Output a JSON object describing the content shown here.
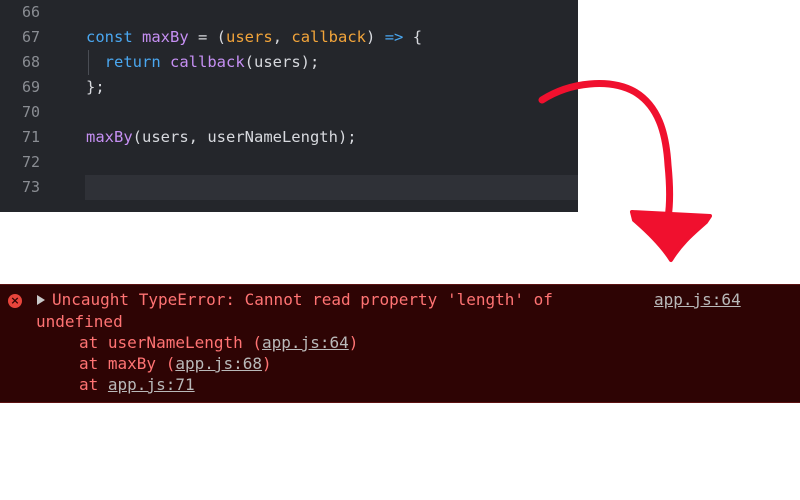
{
  "editor": {
    "lines": [
      {
        "number": "66",
        "code": ""
      },
      {
        "number": "67",
        "code": "const maxBy = (users, callback) => {"
      },
      {
        "number": "68",
        "code": "  return callback(users);"
      },
      {
        "number": "69",
        "code": "};"
      },
      {
        "number": "70",
        "code": ""
      },
      {
        "number": "71",
        "code": "maxBy(users, userNameLength);"
      },
      {
        "number": "72",
        "code": ""
      },
      {
        "number": "73",
        "code": ""
      }
    ],
    "tokens": {
      "l67": {
        "const": "const",
        "name": "maxBy",
        "eq": " = (",
        "p1": "users",
        "comma": ", ",
        "p2": "callback",
        "close": ") ",
        "arrow": "=>",
        "brace": " {"
      },
      "l68": {
        "return": "return",
        "fn": "callback",
        "args": "(users);"
      },
      "l69": {
        "text": "};"
      },
      "l71": {
        "fn": "maxBy",
        "args": "(users, userNameLength);"
      }
    }
  },
  "console": {
    "error_icon": "×",
    "message": "Uncaught TypeError: Cannot read property 'length' of",
    "message_cont": "undefined",
    "source_link": "app.js:64",
    "stack": [
      {
        "prefix": "at userNameLength (",
        "link": "app.js:64",
        "suffix": ")"
      },
      {
        "prefix": "at maxBy (",
        "link": "app.js:68",
        "suffix": ")"
      },
      {
        "prefix": "at ",
        "link": "app.js:71",
        "suffix": ""
      }
    ]
  },
  "colors": {
    "editor_bg": "#24262b",
    "console_bg": "#2e0404",
    "error_text": "#ff7373",
    "arrow": "#f0102e"
  }
}
